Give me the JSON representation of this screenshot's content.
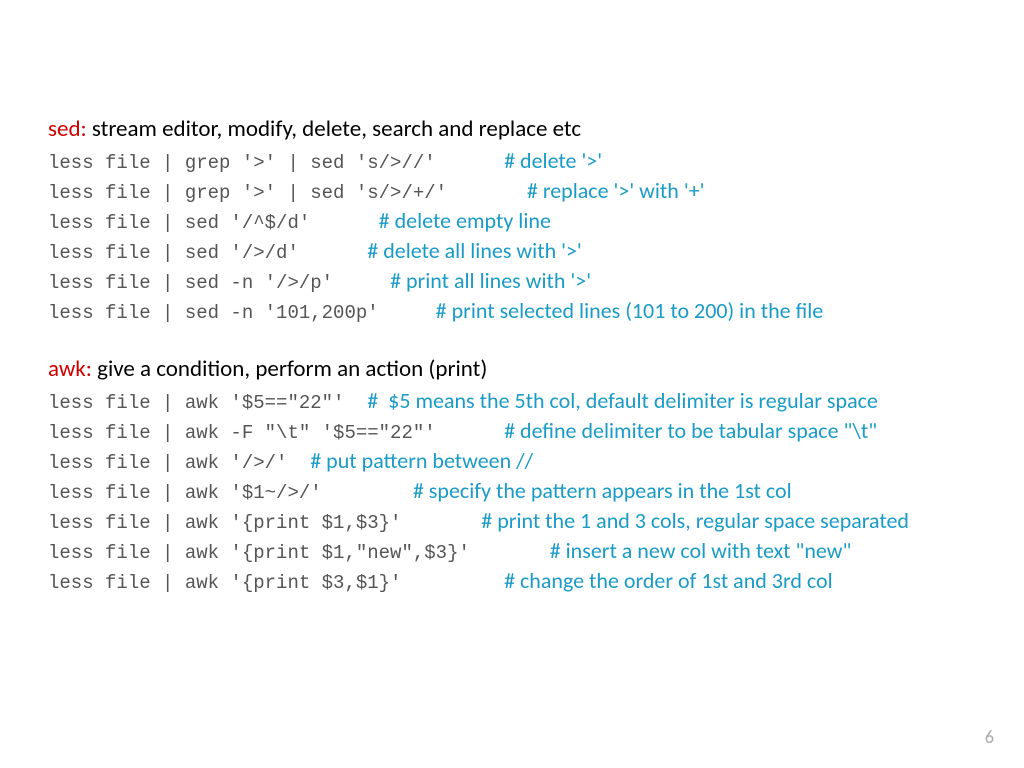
{
  "sed": {
    "title_cmd": "sed:",
    "title_rest": " stream editor, modify, delete, search and replace etc",
    "lines": [
      {
        "code": "less file | grep '>' | sed 's/>//'      ",
        "comment": "# delete '>'"
      },
      {
        "code": "less file | grep '>' | sed 's/>/+/'       ",
        "comment": "# replace '>' with '+'"
      },
      {
        "code": "less file | sed '/^$/d'      ",
        "comment": "# delete empty line"
      },
      {
        "code": "less file | sed '/>/d'      ",
        "comment": "# delete all lines with '>'"
      },
      {
        "code": "less file | sed -n '/>/p'     ",
        "comment": "# print all lines with '>'"
      },
      {
        "code": "less file | sed -n '101,200p'     ",
        "comment": "# print selected lines (101 to 200) in the file"
      }
    ]
  },
  "awk": {
    "title_cmd": "awk:",
    "title_rest": " give a condition, perform an action (print)",
    "lines": [
      {
        "code": "less file | awk '$5==\"22\"'  ",
        "comment": "#  $5 means the 5th col, default delimiter is regular space"
      },
      {
        "code": "less file | awk -F \"\\t\" '$5==\"22\"'      ",
        "comment": "# define delimiter to be tabular space \"\\t\""
      },
      {
        "code": "less file | awk '/>/'  ",
        "comment": "# put pattern between //"
      },
      {
        "code": "less file | awk '$1~/>/'        ",
        "comment": "# specify the pattern appears in the 1st col"
      },
      {
        "code": "less file | awk '{print $1,$3}'       ",
        "comment": "# print the 1 and 3 cols, regular space separated"
      },
      {
        "code": "less file | awk '{print $1,\"new\",$3}'       ",
        "comment": "# insert a new col with text \"new\""
      },
      {
        "code": "less file | awk '{print $3,$1}'         ",
        "comment": "# change the order of 1st and 3rd col"
      }
    ]
  },
  "page_number": "6"
}
